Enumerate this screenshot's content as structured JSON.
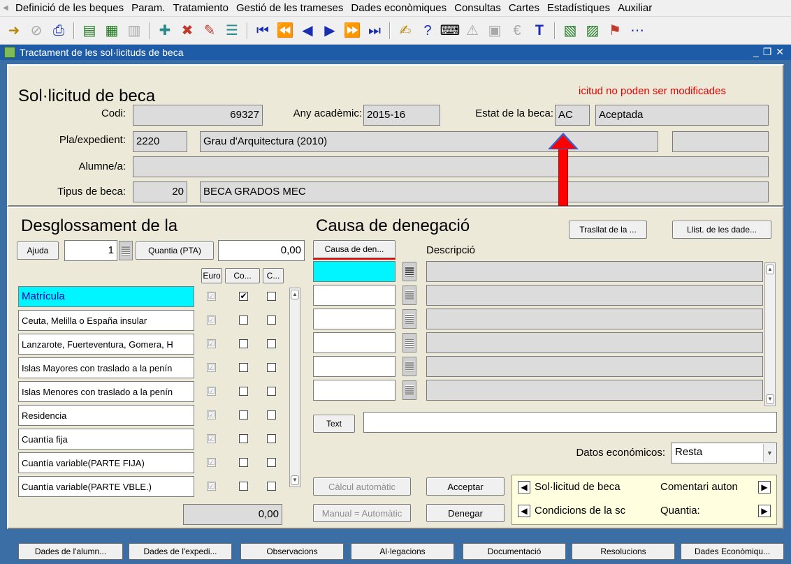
{
  "menu": [
    "Definició de les beques",
    "Param.",
    "Tratamiento",
    "Gestió de les trameses",
    "Dades econòmiques",
    "Consultas",
    "Cartes",
    "Estadístiques",
    "Auxiliar"
  ],
  "window": {
    "title": "Tractament de les sol·licituds de beca"
  },
  "header": {
    "title": "Sol·licitud de beca",
    "warning": "icitud no poden ser modificades",
    "codi_label": "Codi:",
    "codi_value": "69327",
    "any_label": "Any acadèmic:",
    "any_value": "2015-16",
    "estat_label": "Estat de la beca:",
    "estat_code": "AC",
    "estat_desc": "Aceptada",
    "pla_label": "Pla/expedient:",
    "pla_code": "2220",
    "pla_desc": "Grau d'Arquitectura (2010)",
    "alumne_label": "Alumne/a:",
    "alumne_value": "",
    "tipus_label": "Tipus de beca:",
    "tipus_code": "20",
    "tipus_desc": "BECA GRADOS MEC"
  },
  "desglossament": {
    "title": "Desglossament de la",
    "ajuda_label": "Ajuda",
    "ajuda_value": "1",
    "quantia_label": "Quantia (PTA)",
    "quantia_value": "0,00",
    "col_headers": [
      "Euro",
      "Co...",
      "C..."
    ],
    "rows": [
      {
        "label": "Matrícula",
        "c1": "☑",
        "c2": "✔",
        "c3": ""
      },
      {
        "label": "Ceuta, Melilla o España insular",
        "c1": "☑",
        "c2": "",
        "c3": ""
      },
      {
        "label": "Lanzarote, Fuerteventura, Gomera, H",
        "c1": "☑",
        "c2": "",
        "c3": ""
      },
      {
        "label": "Islas Mayores con traslado a la penín",
        "c1": "☑",
        "c2": "",
        "c3": ""
      },
      {
        "label": "Islas Menores con traslado a la penín",
        "c1": "☑",
        "c2": "",
        "c3": ""
      },
      {
        "label": "Residencia",
        "c1": "☑",
        "c2": "",
        "c3": ""
      },
      {
        "label": "Cuantía fija",
        "c1": "☑",
        "c2": "",
        "c3": ""
      },
      {
        "label": "Cuantía variable(PARTE FIJA)",
        "c1": "☑",
        "c2": "",
        "c3": ""
      },
      {
        "label": "Cuantía variable(PARTE VBLE.)",
        "c1": "☑",
        "c2": "",
        "c3": ""
      }
    ],
    "total_value": "0,00"
  },
  "causa": {
    "title": "Causa de denegació",
    "btn_trasllat": "Trasllat de la ...",
    "btn_llist": "Llist. de les dade...",
    "col_causa": "Causa de den...",
    "col_desc": "Descripció",
    "text_button": "Text",
    "datos_label": "Datos económicos:",
    "datos_value": "Resta"
  },
  "actions": {
    "calcul": "Càlcul automàtic",
    "manual": "Manual = Automàtic",
    "acceptar": "Acceptar",
    "denegar": "Denegar"
  },
  "nav": {
    "prev1": "Sol·licitud de beca",
    "next1": "Comentari auton",
    "prev2": "Condicions de la sc",
    "next2": "Quantia:"
  },
  "bottom_buttons": [
    "Dades de l'alumn...",
    "Dades de l'expedi...",
    "Observacions",
    "Al·legacions",
    "Documentació",
    "Resolucions",
    "Dades Econòmiqu..."
  ]
}
